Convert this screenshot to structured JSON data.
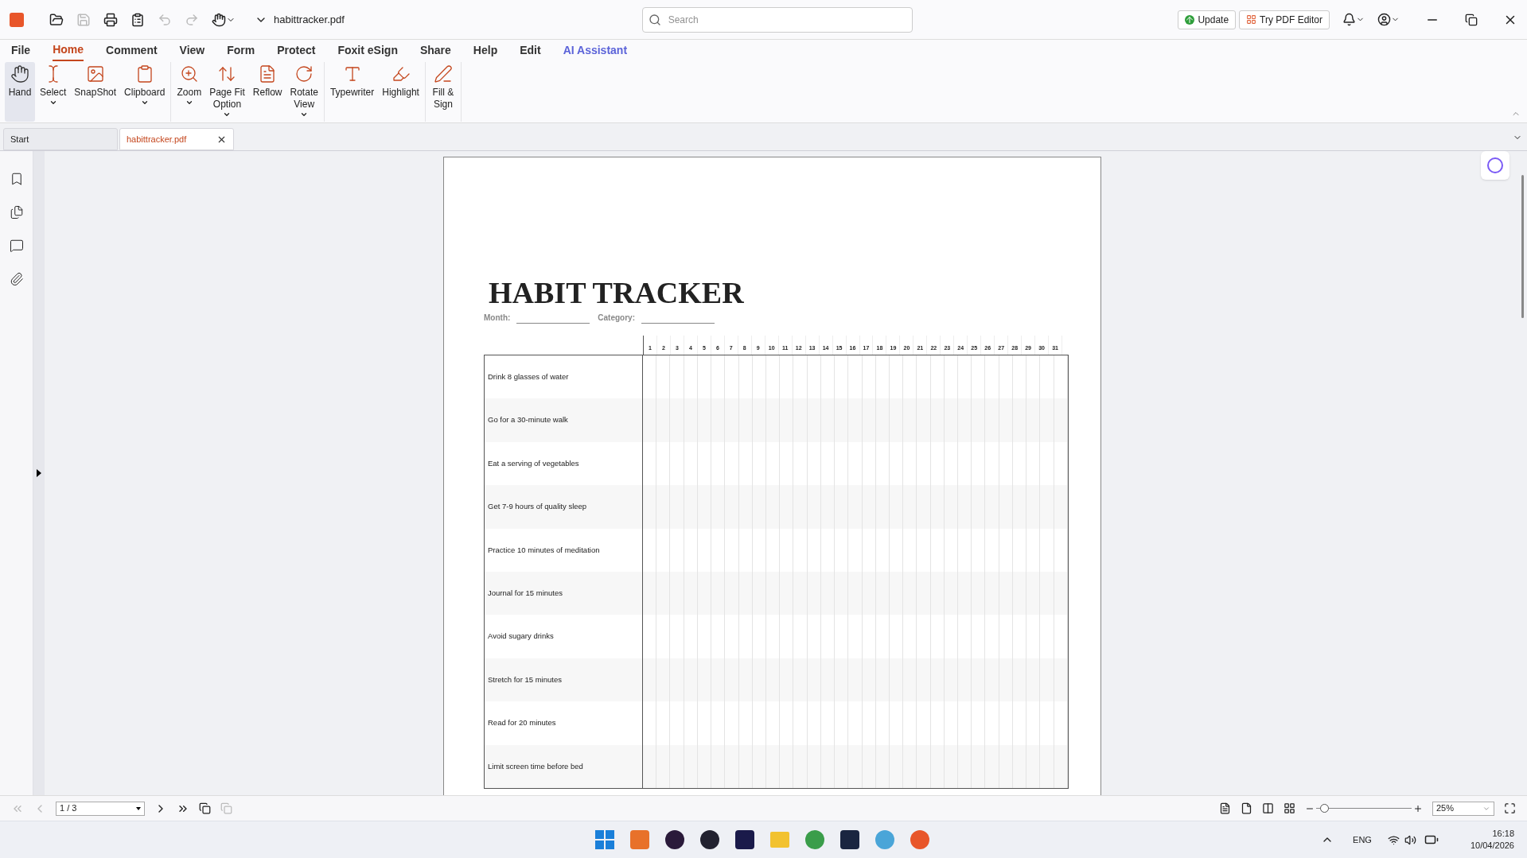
{
  "window": {
    "file_name": "habittracker.pdf",
    "search_placeholder": "Search",
    "update_button": "Update",
    "try_editor_button": "Try PDF Editor"
  },
  "menu": [
    {
      "label": "File",
      "selected": false,
      "kind": "plain"
    },
    {
      "label": "Home",
      "selected": true,
      "kind": "plain"
    },
    {
      "label": "Comment",
      "selected": false,
      "kind": "plain"
    },
    {
      "label": "View",
      "selected": false,
      "kind": "plain"
    },
    {
      "label": "Form",
      "selected": false,
      "kind": "plain"
    },
    {
      "label": "Protect",
      "selected": false,
      "kind": "plain"
    },
    {
      "label": "Foxit eSign",
      "selected": false,
      "kind": "plain"
    },
    {
      "label": "Share",
      "selected": false,
      "kind": "plain"
    },
    {
      "label": "Help",
      "selected": false,
      "kind": "plain"
    },
    {
      "label": "Edit",
      "selected": false,
      "kind": "plain"
    },
    {
      "label": "AI Assistant",
      "selected": false,
      "kind": "ai"
    }
  ],
  "ribbon": [
    [
      {
        "kind": "hand",
        "lines": [
          "Hand"
        ],
        "selected": true,
        "caret": false
      },
      {
        "kind": "select",
        "lines": [
          "Select"
        ],
        "selected": false,
        "caret": true
      },
      {
        "kind": "snapshot",
        "lines": [
          "SnapShot"
        ],
        "selected": false,
        "caret": false
      },
      {
        "kind": "clipboard",
        "lines": [
          "Clipboard"
        ],
        "selected": false,
        "caret": true
      }
    ],
    [
      {
        "kind": "zoom",
        "lines": [
          "Zoom"
        ],
        "selected": false,
        "caret": true
      },
      {
        "kind": "pagefit",
        "lines": [
          "Page Fit",
          "Option"
        ],
        "selected": false,
        "caret": true
      },
      {
        "kind": "reflow",
        "lines": [
          "Reflow"
        ],
        "selected": false,
        "caret": false
      },
      {
        "kind": "rotate",
        "lines": [
          "Rotate",
          "View"
        ],
        "selected": false,
        "caret": true
      }
    ],
    [
      {
        "kind": "typewriter",
        "lines": [
          "Typewriter"
        ],
        "selected": false,
        "caret": false
      },
      {
        "kind": "highlight",
        "lines": [
          "Highlight"
        ],
        "selected": false,
        "caret": false
      }
    ],
    [
      {
        "kind": "fillsign",
        "lines": [
          "Fill &",
          "Sign"
        ],
        "selected": false,
        "caret": false
      }
    ]
  ],
  "doc_tabs": [
    {
      "label": "Start",
      "selected": false,
      "closable": false
    },
    {
      "label": "habittracker.pdf",
      "selected": true,
      "closable": true
    }
  ],
  "document": {
    "title": "HABIT TRACKER",
    "month_label": "Month:",
    "category_label": "Category:",
    "days": [
      "1",
      "2",
      "3",
      "4",
      "5",
      "6",
      "7",
      "8",
      "9",
      "10",
      "11",
      "12",
      "13",
      "14",
      "15",
      "16",
      "17",
      "18",
      "19",
      "20",
      "21",
      "22",
      "23",
      "24",
      "25",
      "26",
      "27",
      "28",
      "29",
      "30",
      "31"
    ],
    "habits": [
      "Drink 8 glasses of water",
      "Go for a 30-minute walk",
      "Eat a serving of vegetables",
      "Get 7-9 hours of quality sleep",
      "Practice 10 minutes of meditation",
      "Journal for 15 minutes",
      "Avoid sugary drinks",
      "Stretch for 15 minutes",
      "Read for 20 minutes",
      "Limit screen time before bed"
    ]
  },
  "status_bar": {
    "page": "1 / 3",
    "zoom": "25%",
    "zoom_level": {
      "level": 0.08
    }
  },
  "taskbar": {
    "language": "ENG",
    "time": "16:18",
    "date": "10/04/2026"
  }
}
